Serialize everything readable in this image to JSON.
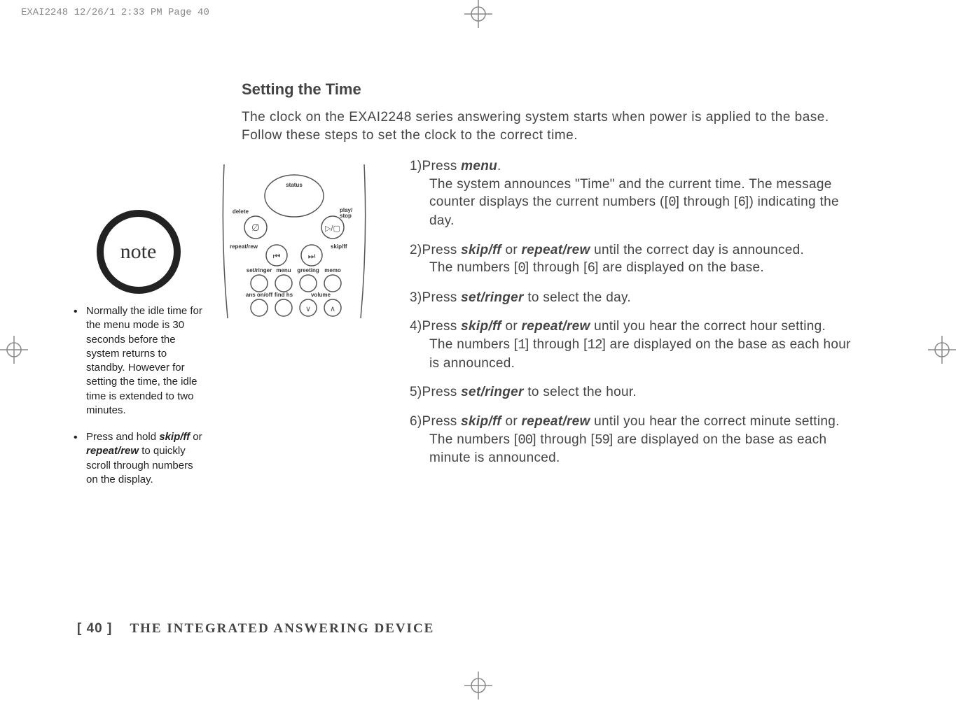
{
  "header_slug": "EXAI2248  12/26/1 2:33 PM  Page 40",
  "title": "Setting the Time",
  "intro": "The clock on the EXAI2248 series answering system starts when power is applied to the base. Follow these steps to set the clock to the correct time.",
  "note": {
    "label": "note",
    "items": [
      {
        "pre": "Normally the idle time for the menu mode is 30 seconds before the system returns to standby. However for setting the time, the idle time is extended to two minutes."
      },
      {
        "pre": "Press and hold ",
        "b1": "skip/ff",
        "mid": " or ",
        "b2": "repeat/rew",
        "post": " to quickly scroll through numbers on the display."
      }
    ]
  },
  "device": {
    "labels": {
      "status": "status",
      "delete": "delete",
      "playstop": "play/\nstop",
      "repeatrew": "repeat/rew",
      "skipff": "skip/ff",
      "setringer": "set/ringer",
      "menu": "menu",
      "greeting": "greeting",
      "memo": "memo",
      "ansonoff": "ans on/off",
      "findhs": "find hs",
      "volume": "volume"
    }
  },
  "steps": [
    {
      "num": "1)",
      "parts": [
        {
          "t": "Press "
        },
        {
          "kw": "menu"
        },
        {
          "t": "."
        },
        {
          "br": true
        },
        {
          "t": "The system announces \"Time\" and the current time. The message counter displays the current numbers (["
        },
        {
          "seg": "0"
        },
        {
          "t": "] through ["
        },
        {
          "seg": "6"
        },
        {
          "t": "]) indicating the day."
        }
      ]
    },
    {
      "num": "2)",
      "parts": [
        {
          "t": "Press "
        },
        {
          "kw": "skip/ff"
        },
        {
          "t": " or "
        },
        {
          "kw": "repeat/rew"
        },
        {
          "t": " until the correct day is announced."
        },
        {
          "br": true
        },
        {
          "t": "The numbers ["
        },
        {
          "seg": "0"
        },
        {
          "t": "] through ["
        },
        {
          "seg": "6"
        },
        {
          "t": "] are displayed on the base."
        }
      ]
    },
    {
      "num": "3)",
      "parts": [
        {
          "t": "Press "
        },
        {
          "kw": "set/ringer"
        },
        {
          "t": " to select the day."
        }
      ]
    },
    {
      "num": "4)",
      "parts": [
        {
          "t": "Press "
        },
        {
          "kw": "skip/ff"
        },
        {
          "t": " or "
        },
        {
          "kw": "repeat/rew"
        },
        {
          "t": " until you hear the correct hour setting. The numbers ["
        },
        {
          "seg": "1"
        },
        {
          "t": "] through ["
        },
        {
          "seg": "12"
        },
        {
          "t": "] are displayed on the base as each hour is announced."
        }
      ]
    },
    {
      "num": "5)",
      "parts": [
        {
          "t": "Press "
        },
        {
          "kw": "set/ringer"
        },
        {
          "t": " to select the hour."
        }
      ]
    },
    {
      "num": "6)",
      "parts": [
        {
          "t": "Press "
        },
        {
          "kw": "skip/ff"
        },
        {
          "t": " or "
        },
        {
          "kw": "repeat/rew"
        },
        {
          "t": " until you hear the correct minute setting. The numbers ["
        },
        {
          "seg": "00"
        },
        {
          "t": "] through ["
        },
        {
          "seg": "59"
        },
        {
          "t": "] are displayed on the base as each minute is announced."
        }
      ]
    }
  ],
  "footer": {
    "page": "[ 40 ]",
    "section": "THE INTEGRATED ANSWERING DEVICE"
  }
}
